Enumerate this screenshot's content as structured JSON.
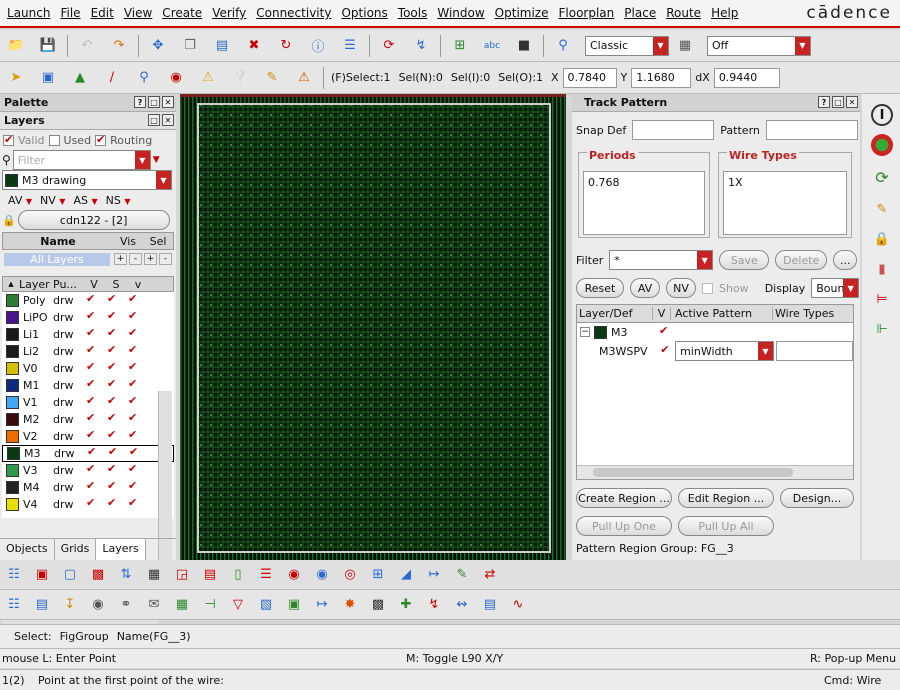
{
  "menu": [
    "Launch",
    "File",
    "Edit",
    "View",
    "Create",
    "Verify",
    "Connectivity",
    "Options",
    "Tools",
    "Window",
    "Optimize",
    "Floorplan",
    "Place",
    "Route",
    "Help"
  ],
  "brand": "cādence",
  "toolbar": {
    "mode_combo": "Classic",
    "off_combo": "Off",
    "status": {
      "select": "(F)Select:1",
      "seln": "Sel(N):0",
      "seli": "Sel(I):0",
      "selo": "Sel(O):1"
    },
    "x_label": "X",
    "x_value": "0.7840",
    "y_label": "Y",
    "y_value": "1.1680",
    "dx_label": "dX",
    "dx_value": "0.9440"
  },
  "palette": {
    "title": "Palette",
    "layers_title": "Layers",
    "valid": "Valid",
    "used": "Used",
    "routing": "Routing",
    "filter_placeholder": "Filter",
    "current_layer": "M3 drawing",
    "av": "AV",
    "nv": "NV",
    "as": "AS",
    "ns": "NS",
    "cell": "cdn122 - [2]",
    "name_col": "Name",
    "vis_col": "Vis",
    "sel_col": "Sel",
    "all_layers": "All Layers",
    "cols": {
      "layer": "Layer",
      "purpose": "Pu...",
      "v": "V",
      "s": "S",
      "vv": "v"
    },
    "layers": [
      {
        "name": "Poly",
        "purpose": "drw",
        "color": "#2e7d32"
      },
      {
        "name": "LiPO",
        "purpose": "drw",
        "color": "#4a148c"
      },
      {
        "name": "Li1",
        "purpose": "drw",
        "color": "#1a1a1a"
      },
      {
        "name": "Li2",
        "purpose": "drw",
        "color": "#1a1a1a"
      },
      {
        "name": "V0",
        "purpose": "drw",
        "color": "#d4c000"
      },
      {
        "name": "M1",
        "purpose": "drw",
        "color": "#0d2a80"
      },
      {
        "name": "V1",
        "purpose": "drw",
        "color": "#42a5f5"
      },
      {
        "name": "M2",
        "purpose": "drw",
        "color": "#3a0a0a"
      },
      {
        "name": "V2",
        "purpose": "drw",
        "color": "#ef6c00"
      },
      {
        "name": "M3",
        "purpose": "drw",
        "color": "#0b3a12"
      },
      {
        "name": "V3",
        "purpose": "drw",
        "color": "#2e9a4c"
      },
      {
        "name": "M4",
        "purpose": "drw",
        "color": "#222"
      },
      {
        "name": "V4",
        "purpose": "drw",
        "color": "#e8e000"
      }
    ],
    "tabs": [
      "Objects",
      "Grids",
      "Layers"
    ]
  },
  "track": {
    "title": "Track Pattern",
    "snap_def": "Snap Def",
    "pattern": "Pattern",
    "periods_label": "Periods",
    "periods_value": "0.768",
    "wire_types_label": "Wire Types",
    "wire_types_value": "1X",
    "filter_label": "Filter",
    "filter_value": "*",
    "save": "Save",
    "delete": "Delete",
    "more": "...",
    "reset": "Reset",
    "av": "AV",
    "nv": "NV",
    "show": "Show",
    "display": "Display",
    "display_value": "Bound",
    "cols": {
      "layer": "Layer/Def",
      "v": "V",
      "active": "Active Pattern",
      "wire": "Wire Types"
    },
    "row1": "M3",
    "row2": "M3WSPV",
    "row2_pattern": "minWidth",
    "create_region": "Create Region ...",
    "edit_region": "Edit Region ...",
    "design": "Design...",
    "pull_up_one": "Pull Up One",
    "pull_up_all": "Pull Up All",
    "group": "Pattern Region Group: FG__3"
  },
  "select_line": {
    "select": "Select:",
    "fig": "FigGroup",
    "name": "Name(FG__3)"
  },
  "mouse_line": {
    "left": "mouse L: Enter Point",
    "mid": "M: Toggle L90 X/Y",
    "right": "R: Pop-up Menu"
  },
  "cmd_line": {
    "num": "1(2)",
    "prompt": "Point at the first point of the wire:",
    "cmd": "Cmd: Wire"
  }
}
